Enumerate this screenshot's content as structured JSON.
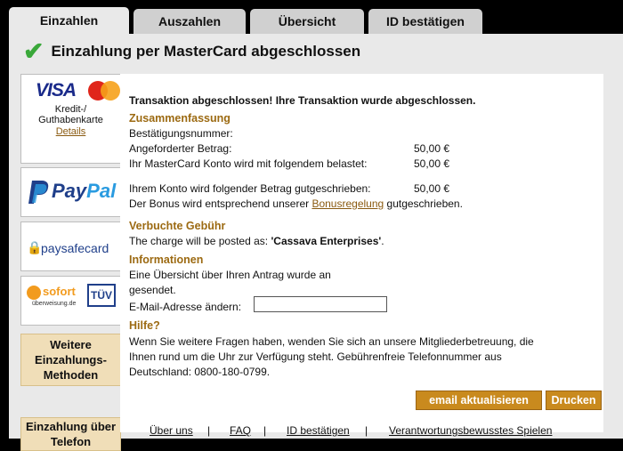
{
  "tabs": [
    {
      "label": "Einzahlen",
      "active": true
    },
    {
      "label": "Auszahlen"
    },
    {
      "label": "Übersicht"
    },
    {
      "label": "ID bestätigen"
    }
  ],
  "header": {
    "title": "Einzahlung per MasterCard abgeschlossen"
  },
  "sidebar": {
    "visa": {
      "brand": "VISA",
      "subtitle1": "Kredit-/",
      "subtitle2": "Guthabenkarte",
      "details": "Details"
    },
    "paypal": {
      "text1": "Pay",
      "text2": "Pal"
    },
    "paysafecard": {
      "text": "paysafecard"
    },
    "sofort": {
      "text": "sofort",
      "sub": "überweisung.de",
      "tuv": "TÜV"
    },
    "more_methods": "Weitere Einzahlungs-Methoden",
    "phone": "Einzahlung über Telefon"
  },
  "content": {
    "success_text": "Transaktion abgeschlossen! Ihre Transaktion wurde abgeschlossen.",
    "summary_heading": "Zusammenfassung",
    "confirmation_label": "Bestätigungsnummer:",
    "requested_label": "Angeforderter Betrag:",
    "requested_value": "50,00 €",
    "charged_label": "Ihr MasterCard Konto wird mit folgendem belastet:",
    "charged_value": "50,00 €",
    "credited_label": "Ihrem Konto wird folgender Betrag gutgeschrieben:",
    "credited_value": "50,00 €",
    "bonus_prefix": "Der Bonus wird entsprechend unserer",
    "bonus_link": "Bonusregelung",
    "bonus_suffix": "gutgeschrieben.",
    "fee_heading": "Verbuchte Gebühr",
    "charge_prefix": "The charge will be posted as:",
    "charge_name": "'Cassava Enterprises'",
    "charge_suffix": ".",
    "info_heading": "Informationen",
    "info_line1": "Eine Übersicht über Ihren Antrag wurde an",
    "info_line2": "gesendet.",
    "email_label": "E-Mail-Adresse ändern:",
    "email_value": "",
    "help_heading": "Hilfe?",
    "help_line1": "Wenn Sie weitere Fragen haben, wenden Sie sich an unsere Mitgliederbetreuung, die",
    "help_line2": "Ihnen rund um die Uhr zur Verfügung steht. Gebührenfreie Telefonnummer aus",
    "help_line3": "Deutschland: 0800-180-0799.",
    "update_email_button": "email aktualisieren",
    "print_button": "Drucken"
  },
  "footer": {
    "links": [
      "Über uns",
      "FAQ",
      "ID bestätigen",
      "Verantwortungsbewusstes Spielen"
    ],
    "separator": "|"
  },
  "colors": {
    "accent_brown": "#9c6a12",
    "button_orange": "#c98a1e",
    "side_orange": "#f0deb8",
    "check_green": "#3aa83a"
  }
}
